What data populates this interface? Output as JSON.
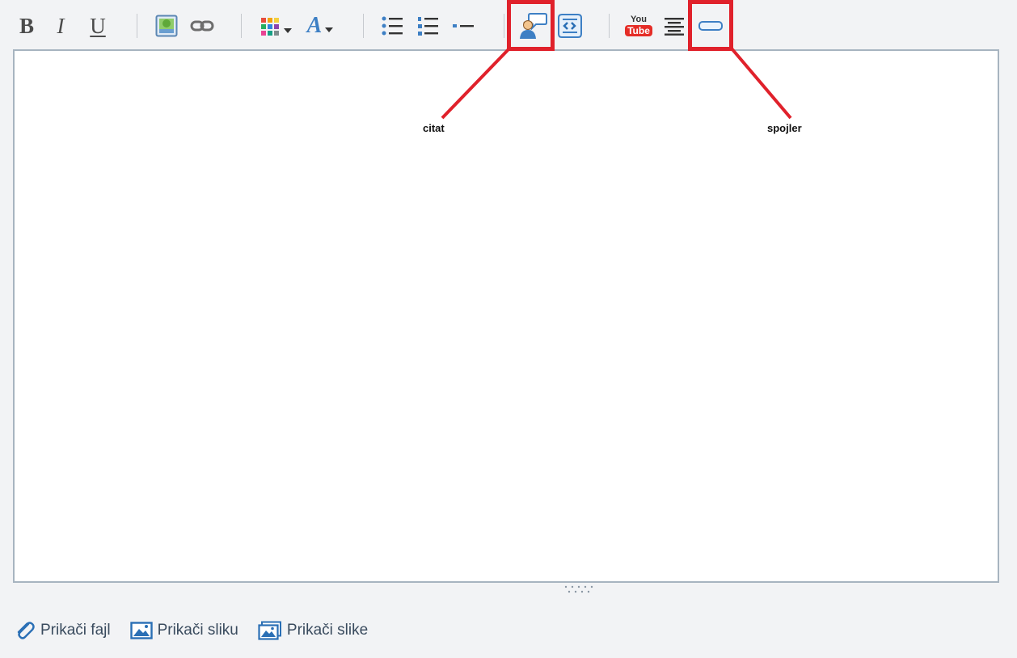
{
  "toolbar": {
    "bold": "B",
    "italic": "I",
    "underline": "U",
    "font_letter": "A",
    "youtube_top": "You",
    "youtube_bottom": "Tube"
  },
  "icons": {
    "bold": "bold-icon",
    "italic": "italic-icon",
    "underline": "underline-icon",
    "image": "image-icon",
    "link": "link-icon",
    "color": "color-grid-icon",
    "font": "font-icon",
    "bullet_list": "bulleted-list-icon",
    "numbered_list": "numbered-list-icon",
    "horizontal_rule": "horizontal-rule-icon",
    "quote": "quote-person-icon",
    "code": "code-scroll-icon",
    "youtube": "youtube-icon",
    "align_center": "align-center-icon",
    "spoiler": "spoiler-icon",
    "attach_file": "paperclip-icon",
    "attach_image": "image-icon",
    "attach_images": "images-icon"
  },
  "annotations": {
    "quote_label": "citat",
    "spoiler_label": "spojler",
    "highlight_color": "#e0212b"
  },
  "attachments": {
    "file_label": "Prikači fajl",
    "image_label": "Prikači sliku",
    "images_label": "Prikači slike"
  },
  "colors": {
    "background": "#f2f3f5",
    "editor_border": "#a7b4c0",
    "accent_blue": "#2a6fb5",
    "youtube_red": "#e52d27"
  }
}
